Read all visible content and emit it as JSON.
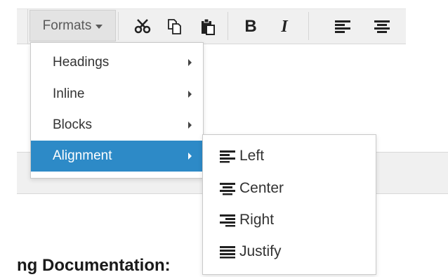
{
  "toolbar": {
    "formats_label": "Formats",
    "bold_label": "B",
    "italic_label": "I",
    "icons": [
      "cut-icon",
      "copy-icon",
      "paste-icon",
      "bold-icon",
      "italic-icon",
      "align-left-icon",
      "align-center-icon"
    ]
  },
  "formats_menu": {
    "items": [
      {
        "label": "Headings"
      },
      {
        "label": "Inline"
      },
      {
        "label": "Blocks"
      },
      {
        "label": "Alignment"
      }
    ],
    "active_item": "Alignment"
  },
  "alignment_submenu": {
    "items": [
      {
        "label": "Left",
        "icon": "align-left-icon"
      },
      {
        "label": "Center",
        "icon": "align-center-icon"
      },
      {
        "label": "Right",
        "icon": "align-right-icon"
      },
      {
        "label": "Justify",
        "icon": "align-justify-icon"
      }
    ]
  },
  "content": {
    "heading_fragment": "ng Documentation:"
  },
  "colors": {
    "accent": "#2d8ac7",
    "toolbar_bg": "#f0f0f0"
  }
}
